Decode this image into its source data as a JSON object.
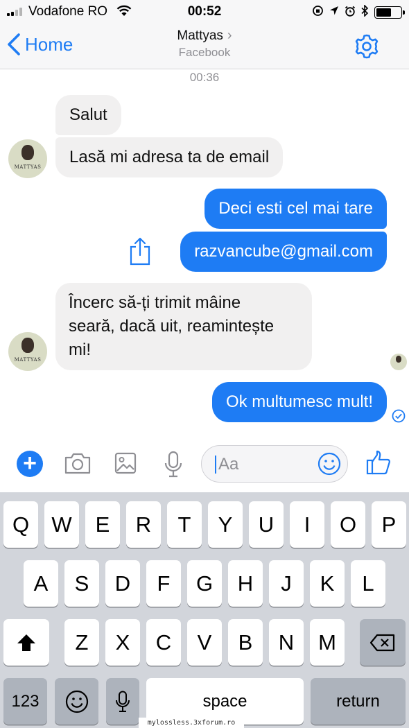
{
  "status_bar": {
    "carrier": "Vodafone RO",
    "time": "00:52"
  },
  "nav": {
    "back_label": "Home",
    "title": "Mattyas",
    "subtitle": "Facebook"
  },
  "conversation": {
    "timestamp": "00:36",
    "messages": [
      {
        "from": "contact",
        "text": "Salut"
      },
      {
        "from": "contact",
        "text": "Lasă mi adresa ta de email"
      },
      {
        "from": "me",
        "text": "Deci esti cel mai tare"
      },
      {
        "from": "me",
        "text": "razvancube@gmail.com"
      },
      {
        "from": "contact",
        "lines": [
          "Încerc să-ți trimit mâine",
          "seară, dacă uit, reamintește",
          "mi!"
        ]
      },
      {
        "from": "me",
        "text": "Ok multumesc mult!"
      }
    ],
    "avatar_text": "MATTYAS"
  },
  "composer": {
    "placeholder": "Aa"
  },
  "keyboard": {
    "row1": [
      "Q",
      "W",
      "E",
      "R",
      "T",
      "Y",
      "U",
      "I",
      "O",
      "P"
    ],
    "row2": [
      "A",
      "S",
      "D",
      "F",
      "G",
      "H",
      "J",
      "K",
      "L"
    ],
    "row3": [
      "Z",
      "X",
      "C",
      "V",
      "B",
      "N",
      "M"
    ],
    "numbers_label": "123",
    "space_label": "space",
    "return_label": "return"
  },
  "watermark": "mylossless.3xforum.ro",
  "colors": {
    "accent": "#1e7cf4",
    "incoming_bubble": "#f1f0f0",
    "keyboard_bg": "#d2d5db"
  }
}
